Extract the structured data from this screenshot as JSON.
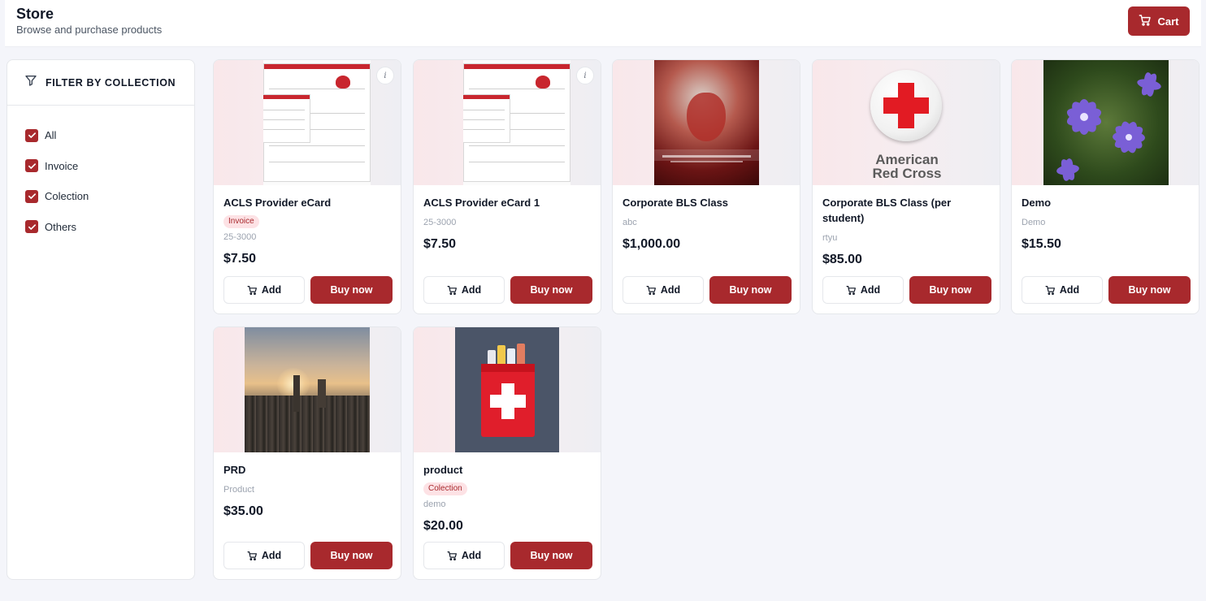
{
  "header": {
    "title": "Store",
    "subtitle": "Browse and purchase products",
    "cart_label": "Cart"
  },
  "sidebar": {
    "heading": "FILTER BY COLLECTION",
    "filters": [
      {
        "label": "All",
        "checked": true
      },
      {
        "label": "Invoice",
        "checked": true
      },
      {
        "label": "Colection",
        "checked": true
      },
      {
        "label": "Others",
        "checked": true
      }
    ]
  },
  "buttons": {
    "add": "Add",
    "buy": "Buy now"
  },
  "products": [
    {
      "name": "ACLS Provider eCard",
      "badge": "Invoice",
      "sub": "25-3000",
      "price": "$7.50"
    },
    {
      "name": "ACLS Provider eCard 1",
      "sub": "25-3000",
      "price": "$7.50"
    },
    {
      "name": "Corporate BLS Class",
      "sub": "abc",
      "price": "$1,000.00"
    },
    {
      "name": "Corporate BLS Class (per student)",
      "sub": "rtyu",
      "price": "$85.00",
      "image_text": [
        "American",
        "Red Cross"
      ]
    },
    {
      "name": "Demo",
      "sub": "Demo",
      "price": "$15.50"
    },
    {
      "name": "PRD",
      "sub": "Product",
      "price": "$35.00"
    },
    {
      "name": "product",
      "badge": "Colection",
      "sub": "demo",
      "price": "$20.00"
    }
  ],
  "colors": {
    "brand": "#a8292d",
    "badge_bg": "#fde2e5",
    "page_bg": "#f4f5fa"
  },
  "icons": {
    "cart": "cart-icon",
    "filter": "filter-icon",
    "info": "info-icon",
    "check": "check-icon"
  }
}
